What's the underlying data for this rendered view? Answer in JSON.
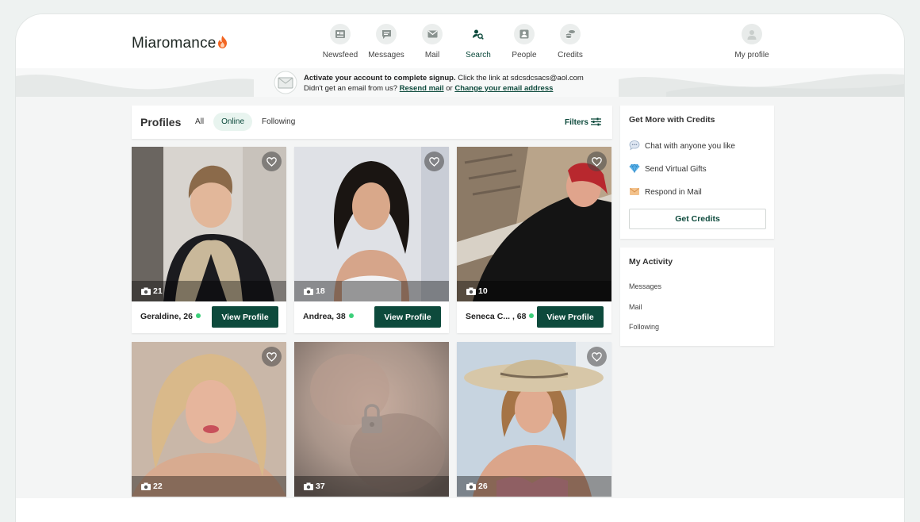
{
  "app": {
    "logo_text": "Miaromance"
  },
  "nav": {
    "items": [
      {
        "label": "Newsfeed",
        "icon": "newsfeed-icon"
      },
      {
        "label": "Messages",
        "icon": "messages-icon"
      },
      {
        "label": "Mail",
        "icon": "mail-icon"
      },
      {
        "label": "Search",
        "icon": "search-icon"
      },
      {
        "label": "People",
        "icon": "people-icon"
      },
      {
        "label": "Credits",
        "icon": "credits-icon"
      }
    ],
    "active": "Search",
    "profile_label": "My profile"
  },
  "banner": {
    "bold": "Activate your account to complete signup.",
    "line1_rest": " Click the link at sdcsdcsacs@aol.com",
    "line2_prefix": "Didn't get an email from us? ",
    "resend_link": "Resend mail",
    "or": " or ",
    "change_link": "Change your email address"
  },
  "profiles": {
    "title": "Profiles",
    "tabs": [
      "All",
      "Online",
      "Following"
    ],
    "active_tab": "Online",
    "filters_label": "Filters",
    "view_label": "View Profile",
    "cards": [
      {
        "name": "Geraldine, 26",
        "photos": "21",
        "online": true
      },
      {
        "name": "Andrea, 38",
        "photos": "18",
        "online": true
      },
      {
        "name": "Seneca C... , 68",
        "photos": "10",
        "online": true
      },
      {
        "name": "",
        "photos": "22",
        "online": false
      },
      {
        "name": "",
        "photos": "37",
        "online": false,
        "locked": true
      },
      {
        "name": "",
        "photos": "26",
        "online": false
      }
    ]
  },
  "credits": {
    "title": "Get More with Credits",
    "features": [
      {
        "label": "Chat with anyone you like",
        "icon": "chat-bubble-icon"
      },
      {
        "label": "Send Virtual Gifts",
        "icon": "diamond-icon"
      },
      {
        "label": "Respond in Mail",
        "icon": "envelope-icon"
      }
    ],
    "button": "Get Credits"
  },
  "activity": {
    "title": "My Activity",
    "items": [
      "Messages",
      "Mail",
      "Following"
    ]
  },
  "colors": {
    "brand": "#0d4a3c",
    "online": "#3ccf7a",
    "accent_flame": "#f26522"
  }
}
